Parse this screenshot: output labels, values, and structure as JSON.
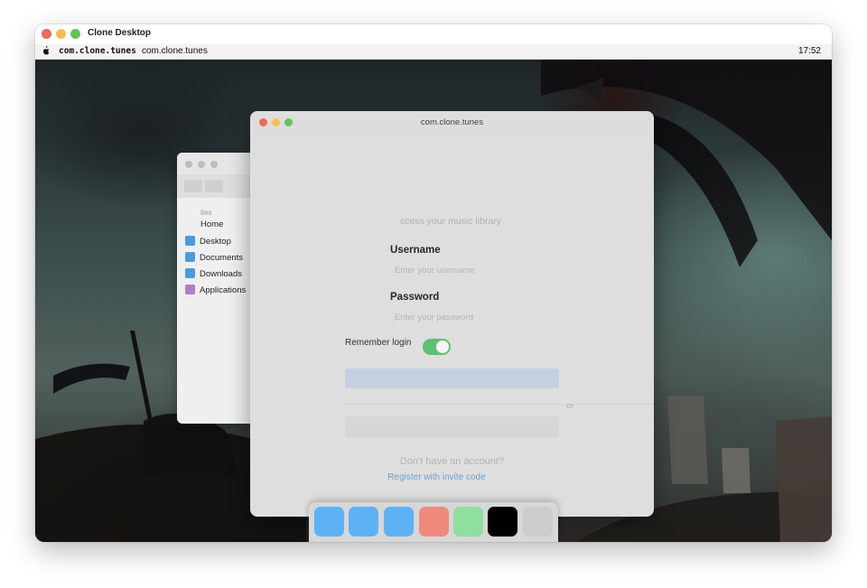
{
  "window": {
    "title": "Clone Desktop",
    "traffic_lights": {
      "close": "#ec6a5e",
      "minimize": "#f4bf4f",
      "zoom": "#61c554"
    }
  },
  "menubar": {
    "apple_glyph": "",
    "app_name_bold": "com.clone.tunes",
    "app_menu": "com.clone.tunes",
    "clock": "17:52"
  },
  "finder": {
    "section_label": "ites",
    "items": [
      {
        "label": "Home",
        "icon": "home-icon",
        "color": ""
      },
      {
        "label": "Desktop",
        "icon": "folder-icon",
        "color": "#4a9be0"
      },
      {
        "label": "Documents",
        "icon": "folder-icon",
        "color": "#4a9be0"
      },
      {
        "label": "Downloads",
        "icon": "folder-icon",
        "color": "#4a9be0"
      },
      {
        "label": "Applications",
        "icon": "applications-icon",
        "color": "#b07ccf"
      }
    ]
  },
  "app": {
    "title": "com.clone.tunes",
    "subtitle": "ccess your music library",
    "username_label": "Username",
    "username_placeholder": "Enter your username",
    "username_value": "",
    "password_label": "Password",
    "password_placeholder": "Enter your password",
    "password_value": "",
    "remember_label": "Remember login",
    "remember_on": true,
    "or_text": "or",
    "no_account_text": "Don't have an account?",
    "register_link": "Register with invite code",
    "accent_color": "#6f9fd0",
    "toggle_color": "#5fbf72"
  },
  "dock": {
    "items": [
      {
        "name": "dock-app-1",
        "color": "#5db2f5"
      },
      {
        "name": "dock-app-2",
        "color": "#5db2f5"
      },
      {
        "name": "dock-app-3",
        "color": "#5db2f5"
      },
      {
        "name": "dock-app-4",
        "color": "#ef8a7a"
      },
      {
        "name": "dock-app-5",
        "color": "#8fdf9f"
      },
      {
        "name": "dock-app-6",
        "color": "#000000"
      },
      {
        "name": "dock-app-7",
        "color": "#cccccc"
      }
    ]
  }
}
